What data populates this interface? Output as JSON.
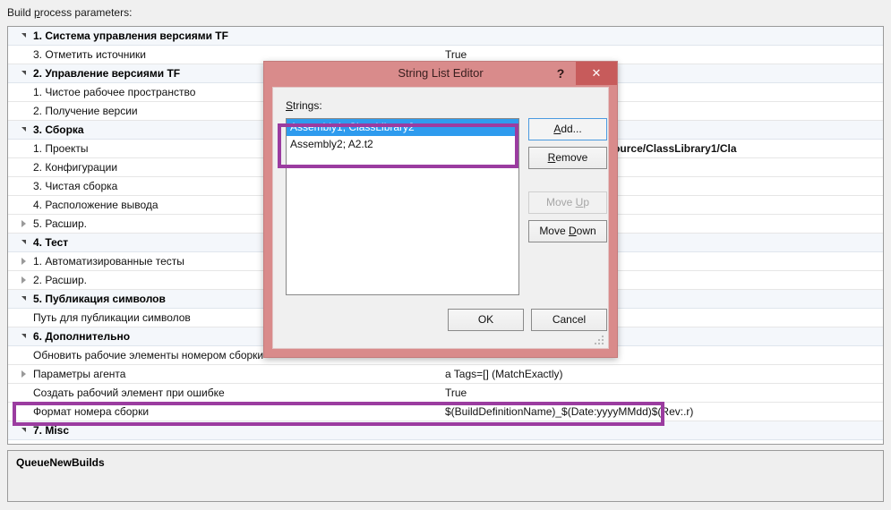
{
  "top_label": {
    "prefix": "Build ",
    "accel": "p",
    "suffix": "rocess parameters:"
  },
  "grid": {
    "rows": [
      {
        "name": "1. Система управления версиями TF",
        "value": "",
        "category": true,
        "expander": "open"
      },
      {
        "name": "3. Отметить источники",
        "value": "True",
        "category": false,
        "expander": "none"
      },
      {
        "name": "2. Управление версиями TF",
        "value": "",
        "category": true,
        "expander": "open"
      },
      {
        "name": "1. Чистое рабочее пространство",
        "value": "",
        "category": false,
        "expander": "none"
      },
      {
        "name": "2. Получение версии",
        "value": "",
        "category": false,
        "expander": "none"
      },
      {
        "name": "3. Сборка",
        "value": "",
        "category": true,
        "expander": "open"
      },
      {
        "name": "1. Проекты",
        "value": "ClassLibrary1.sln,$/Assembly1/Source/ClassLibrary1/Cla",
        "category": false,
        "expander": "none",
        "value_bold": true
      },
      {
        "name": "2. Конфигурации",
        "value": "",
        "category": false,
        "expander": "none"
      },
      {
        "name": "3. Чистая сборка",
        "value": "",
        "category": false,
        "expander": "none"
      },
      {
        "name": "4. Расположение вывода",
        "value": "",
        "category": false,
        "expander": "none"
      },
      {
        "name": "5. Расшир.",
        "value": "",
        "category": false,
        "expander": "closed"
      },
      {
        "name": "4. Тест",
        "value": "",
        "category": true,
        "expander": "open"
      },
      {
        "name": "1. Автоматизированные тесты",
        "value": "",
        "category": false,
        "expander": "closed"
      },
      {
        "name": "2. Расшир.",
        "value": "",
        "category": false,
        "expander": "closed"
      },
      {
        "name": "5. Публикация символов",
        "value": "",
        "category": true,
        "expander": "open"
      },
      {
        "name": "Путь для публикации символов",
        "value": "",
        "category": false,
        "expander": "none"
      },
      {
        "name": "6. Дополнительно",
        "value": "",
        "category": true,
        "expander": "open"
      },
      {
        "name": "Обновить рабочие элементы номером сборки",
        "value": "",
        "category": false,
        "expander": "none"
      },
      {
        "name": "Параметры агента",
        "value": "a Tags=[] (MatchExactly)",
        "category": false,
        "expander": "closed"
      },
      {
        "name": "Создать рабочий элемент при ошибке",
        "value": "True",
        "category": false,
        "expander": "none"
      },
      {
        "name": "Формат номера сборки",
        "value": "$(BuildDefinitionName)_$(Date:yyyyMMdd)$(Rev:.r)",
        "category": false,
        "expander": "none"
      },
      {
        "name": "7. Misc",
        "value": "",
        "category": true,
        "expander": "open"
      },
      {
        "name": "QueueNewBuilds",
        "value": "Assembly1; ClassLibrary2,Assembly2; A2.t2",
        "category": false,
        "expander": "none",
        "value_bold": true
      }
    ]
  },
  "description": {
    "title": "QueueNewBuilds"
  },
  "dialog": {
    "title": "String List Editor",
    "help_glyph": "?",
    "close_glyph": "✕",
    "strings_label": {
      "accel": "S",
      "suffix": "trings:"
    },
    "list_items": [
      {
        "text": "Assembly1; ClassLibrary2",
        "selected": true
      },
      {
        "text": "Assembly2; A2.t2",
        "selected": false
      }
    ],
    "buttons": {
      "add": {
        "prefix": "",
        "accel": "A",
        "suffix": "dd..."
      },
      "remove": {
        "prefix": "",
        "accel": "R",
        "suffix": "emove"
      },
      "move_up": {
        "prefix": "Move ",
        "accel": "U",
        "suffix": "p"
      },
      "move_down": {
        "prefix": "Move ",
        "accel": "D",
        "suffix": "own"
      },
      "ok": "OK",
      "cancel": "Cancel"
    }
  },
  "colors": {
    "highlight_purple": "#9b3ca0",
    "dialog_chrome": "#d98b8b",
    "close_button": "#c75b5b",
    "selection_blue": "#2e9bee"
  }
}
